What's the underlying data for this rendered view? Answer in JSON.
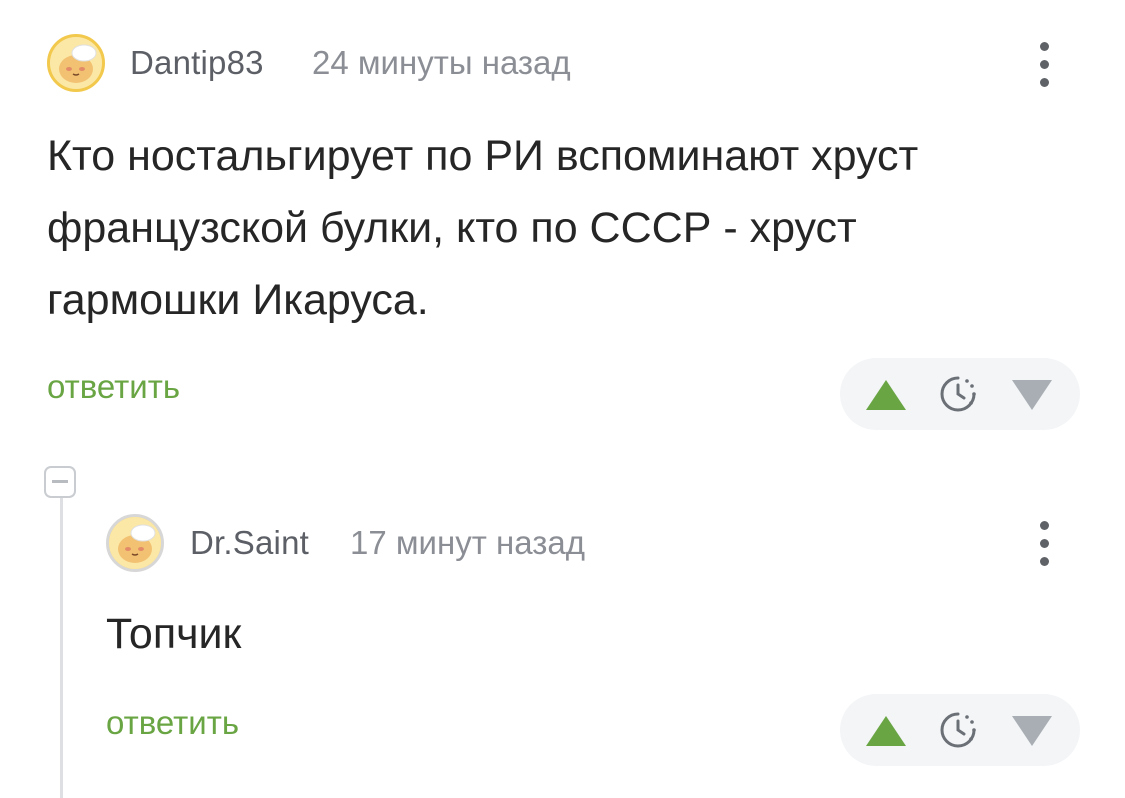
{
  "comments": [
    {
      "username": "Dantip83",
      "timestamp": "24 минуты назад",
      "text": "Кто ностальгирует по РИ вспоминают хруст\nфранцузской булки, кто по СССР - хруст\nгармошки Икаруса.",
      "reply_label": "ответить",
      "avatar_icon": "chef-bun-avatar-icon",
      "more_icon": "more-vertical-icon"
    },
    {
      "username": "Dr.Saint",
      "timestamp": "17 минут назад",
      "text": "Топчик",
      "reply_label": "ответить",
      "avatar_icon": "chef-bun-avatar-icon",
      "more_icon": "more-vertical-icon"
    }
  ],
  "icons": {
    "upvote": "upvote-triangle-icon",
    "clock": "clock-icon",
    "downvote": "downvote-triangle-icon",
    "collapse": "collapse-thread-icon"
  },
  "colors": {
    "accent": "#6aa544",
    "muted": "#8b8e95",
    "pill_bg": "#f3f5f7",
    "downvote": "#a9adb4"
  }
}
